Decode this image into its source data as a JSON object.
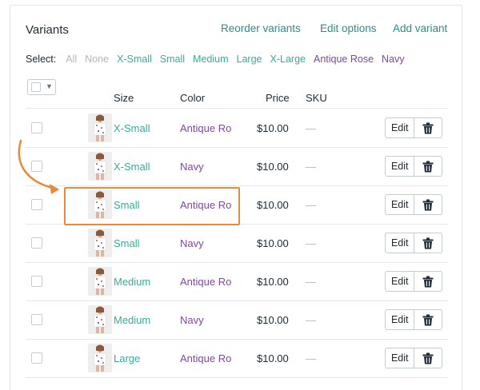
{
  "header": {
    "title": "Variants",
    "reorder_label": "Reorder variants",
    "edit_options_label": "Edit options",
    "add_variant_label": "Add variant"
  },
  "select_bar": {
    "label": "Select:",
    "options": [
      "All",
      "None",
      "X-Small",
      "Small",
      "Medium",
      "Large",
      "X-Large",
      "Antique Rose",
      "Navy"
    ]
  },
  "table": {
    "columns": {
      "size": "Size",
      "color": "Color",
      "price": "Price",
      "sku": "SKU"
    },
    "rows": [
      {
        "size": "X-Small",
        "color": "Antique Ro",
        "price": "$10.00",
        "sku": "—",
        "edit": "Edit"
      },
      {
        "size": "X-Small",
        "color": "Navy",
        "price": "$10.00",
        "sku": "—",
        "edit": "Edit"
      },
      {
        "size": "Small",
        "color": "Antique Ro",
        "price": "$10.00",
        "sku": "—",
        "edit": "Edit"
      },
      {
        "size": "Small",
        "color": "Navy",
        "price": "$10.00",
        "sku": "—",
        "edit": "Edit"
      },
      {
        "size": "Medium",
        "color": "Antique Ro",
        "price": "$10.00",
        "sku": "—",
        "edit": "Edit"
      },
      {
        "size": "Medium",
        "color": "Navy",
        "price": "$10.00",
        "sku": "—",
        "edit": "Edit"
      },
      {
        "size": "Large",
        "color": "Antique Ro",
        "price": "$10.00",
        "sku": "—",
        "edit": "Edit"
      }
    ]
  },
  "icons": {
    "bulk_select": "checkbox-dropdown-icon",
    "delete": "trash-icon",
    "annotation_arrow": "curved-arrow-icon",
    "thumbnail": "product-photo-icon"
  },
  "colors": {
    "link": "#2f8d86",
    "size_option": "#3aab9a",
    "color_option": "#7c4a9b",
    "highlight": "#e88a3c"
  }
}
